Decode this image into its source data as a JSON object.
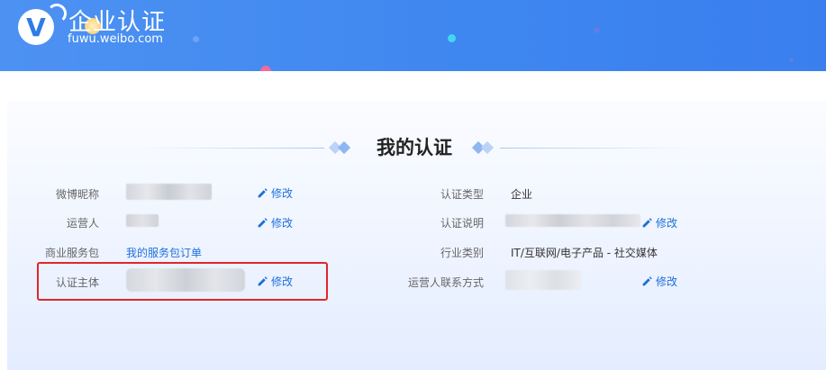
{
  "brand": {
    "title": "企业认证",
    "domain": "fuwu.weibo.com",
    "logo_letter": "V"
  },
  "colors": {
    "header_blue": "#3e86f0",
    "link_blue": "#1e6fd9",
    "highlight_red": "#e0262b"
  },
  "section": {
    "title": "我的认证"
  },
  "left_fields": [
    {
      "label": "微博昵称",
      "value": "",
      "action": "修改"
    },
    {
      "label": "运营人",
      "value": "",
      "action": "修改"
    },
    {
      "label": "商业服务包",
      "value": "我的服务包订单"
    },
    {
      "label": "认证主体",
      "value": "",
      "action": "修改"
    }
  ],
  "right_fields": [
    {
      "label": "认证类型",
      "value": "企业"
    },
    {
      "label": "认证说明",
      "value": "",
      "action": "修改"
    },
    {
      "label": "行业类别",
      "value": "IT/互联网/电子产品 - 社交媒体"
    },
    {
      "label": "运营人联系方式",
      "value": "",
      "action": "修改"
    }
  ],
  "icons": {
    "edit": "pencil-icon"
  }
}
